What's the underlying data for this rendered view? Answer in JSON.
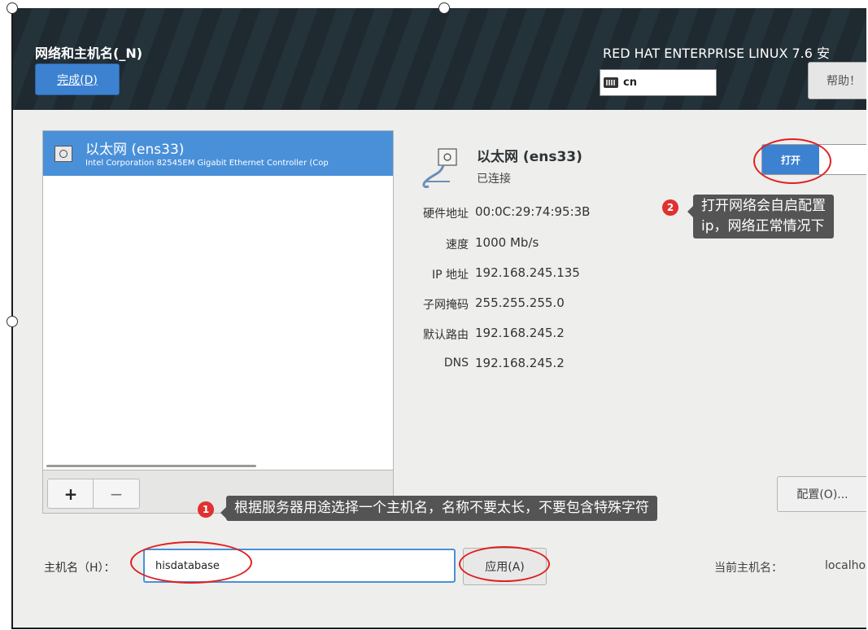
{
  "header": {
    "title": "网络和主机名(_N)",
    "done_label": "完成(D)",
    "product": "RED HAT ENTERPRISE LINUX 7.6 安",
    "keyboard_layout": "cn",
    "help_label": "帮助！"
  },
  "connections": [
    {
      "name": "以太网 (ens33)",
      "description": "Intel Corporation 82545EM Gigabit Ethernet Controller (Cop"
    }
  ],
  "list_controls": {
    "add_label": "+",
    "remove_label": "−"
  },
  "detail": {
    "title": "以太网 (ens33)",
    "status": "已连接",
    "toggle_label": "打开",
    "fields": [
      {
        "label": "硬件地址",
        "value": "00:0C:29:74:95:3B"
      },
      {
        "label": "速度",
        "value": "1000 Mb/s"
      },
      {
        "label": "IP 地址",
        "value": "192.168.245.135"
      },
      {
        "label": "子网掩码",
        "value": "255.255.255.0"
      },
      {
        "label": "默认路由",
        "value": "192.168.245.2"
      },
      {
        "label": "DNS",
        "value": "192.168.245.2"
      }
    ],
    "config_label": "配置(O)..."
  },
  "annotations": [
    {
      "number": "2",
      "text_line1": "打开网络会自启配置",
      "text_line2": "ip，网络正常情况下"
    },
    {
      "number": "1",
      "text": "根据服务器用途选择一个主机名，名称不要太长，不要包含特殊字符"
    }
  ],
  "hostname": {
    "label": "主机名（H）：",
    "value": "hisdatabase",
    "apply_label": "应用(A)",
    "current_label": "当前主机名：",
    "current_value": "localhost"
  },
  "colors": {
    "accent": "#3d82d1",
    "selected_row": "#4a90d9",
    "annotation_red": "#e02020",
    "tooltip": "#545454",
    "header_dark": "#1f2a30"
  }
}
